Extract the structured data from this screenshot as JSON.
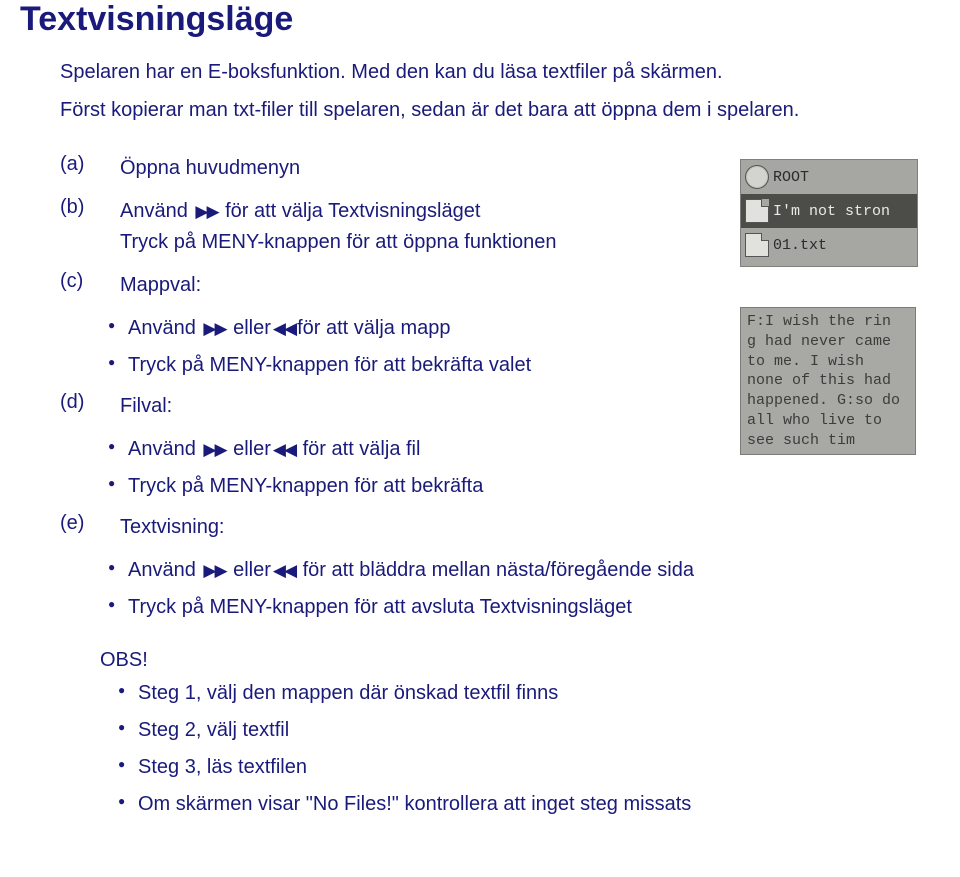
{
  "title": "Textvisningsläge",
  "intro_line1": "Spelaren har en E-boksfunktion. Med den kan du läsa textfiler på skärmen.",
  "intro_line2": "Först kopierar man txt-filer till spelaren, sedan är det bara att öppna dem i spelaren.",
  "steps": {
    "a": {
      "label": "(a)",
      "text": "Öppna huvudmenyn"
    },
    "b": {
      "label": "(b)",
      "text_prefix": "Använd ",
      "text_suffix": " för att välja Textvisningsläget",
      "line2": "Tryck på MENY-knappen för att öppna funktionen"
    },
    "c": {
      "label": "(c)",
      "text": "Mappval:",
      "bullets": [
        {
          "prefix": "Använd ",
          "mid": " eller",
          "suffix": "för att välja mapp"
        },
        {
          "text": "Tryck på MENY-knappen för att bekräfta valet"
        }
      ]
    },
    "d": {
      "label": "(d)",
      "text": "Filval:",
      "bullets": [
        {
          "prefix": "Använd ",
          "mid": " eller",
          "suffix": " för att välja fil"
        },
        {
          "text": "Tryck på MENY-knappen för att bekräfta"
        }
      ]
    },
    "e": {
      "label": "(e)",
      "text": "Textvisning:",
      "bullets": [
        {
          "prefix": "Använd ",
          "mid": " eller",
          "suffix": " för att bläddra mellan nästa/föregående sida"
        },
        {
          "text": "Tryck på MENY-knappen för att avsluta Textvisningsläget"
        }
      ]
    }
  },
  "obs": {
    "title": "OBS!",
    "bullets": [
      "Steg 1, välj den mappen där önskad textfil finns",
      "Steg 2, välj textfil",
      "Steg 3, läs textfilen",
      "Om skärmen visar \"No Files!\" kontrollera att inget steg missats"
    ]
  },
  "screen1": {
    "rows": [
      {
        "icon": "globe",
        "text": "ROOT"
      },
      {
        "icon": "doc",
        "text": "I'm not stron",
        "selected": true
      },
      {
        "icon": "doc",
        "text": "    01.txt"
      }
    ]
  },
  "screen2": {
    "text": "F:I wish the rin g had never came to me.  I wish none of this had happened.  G:so do all who live to see such tim"
  }
}
